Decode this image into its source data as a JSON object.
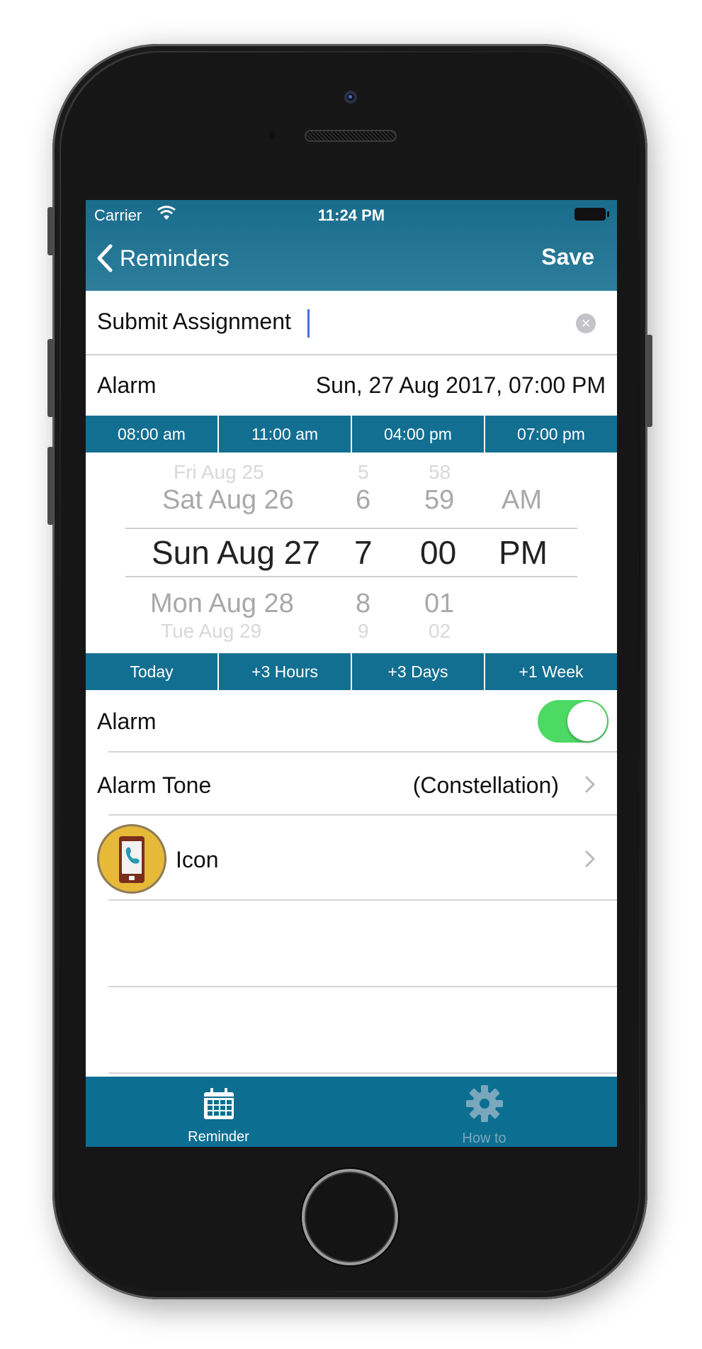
{
  "status_bar": {
    "carrier": "Carrier",
    "time": "11:24 PM"
  },
  "nav": {
    "back_label": "Reminders",
    "save_label": "Save"
  },
  "title_field": {
    "value": "Submit Assignment"
  },
  "alarm_summary": {
    "label": "Alarm",
    "value": "Sun, 27 Aug 2017, 07:00 PM"
  },
  "quick_times": [
    "08:00 am",
    "11:00 am",
    "04:00 pm",
    "07:00 pm"
  ],
  "picker": {
    "dates": [
      "Fri Aug 25",
      "Sat Aug 26",
      "Sun Aug 27",
      "Mon Aug 28",
      "Tue Aug 29"
    ],
    "hours": [
      "5",
      "6",
      "7",
      "8",
      "9"
    ],
    "minutes": [
      "58",
      "59",
      "00",
      "01",
      "02"
    ],
    "ampm": [
      "AM",
      "PM"
    ]
  },
  "quick_offsets": [
    "Today",
    "+3 Hours",
    "+3 Days",
    "+1 Week"
  ],
  "settings": {
    "alarm_label": "Alarm",
    "alarm_on": true,
    "tone_label": "Alarm Tone",
    "tone_value": "(Constellation)",
    "icon_label": "Icon"
  },
  "tabs": {
    "reminder": "Reminder",
    "howto": "How to"
  },
  "colors": {
    "nav": "#2d7d9b",
    "bar": "#136f91",
    "toggle_on": "#4cd964",
    "tabbar": "#0c6f91"
  }
}
